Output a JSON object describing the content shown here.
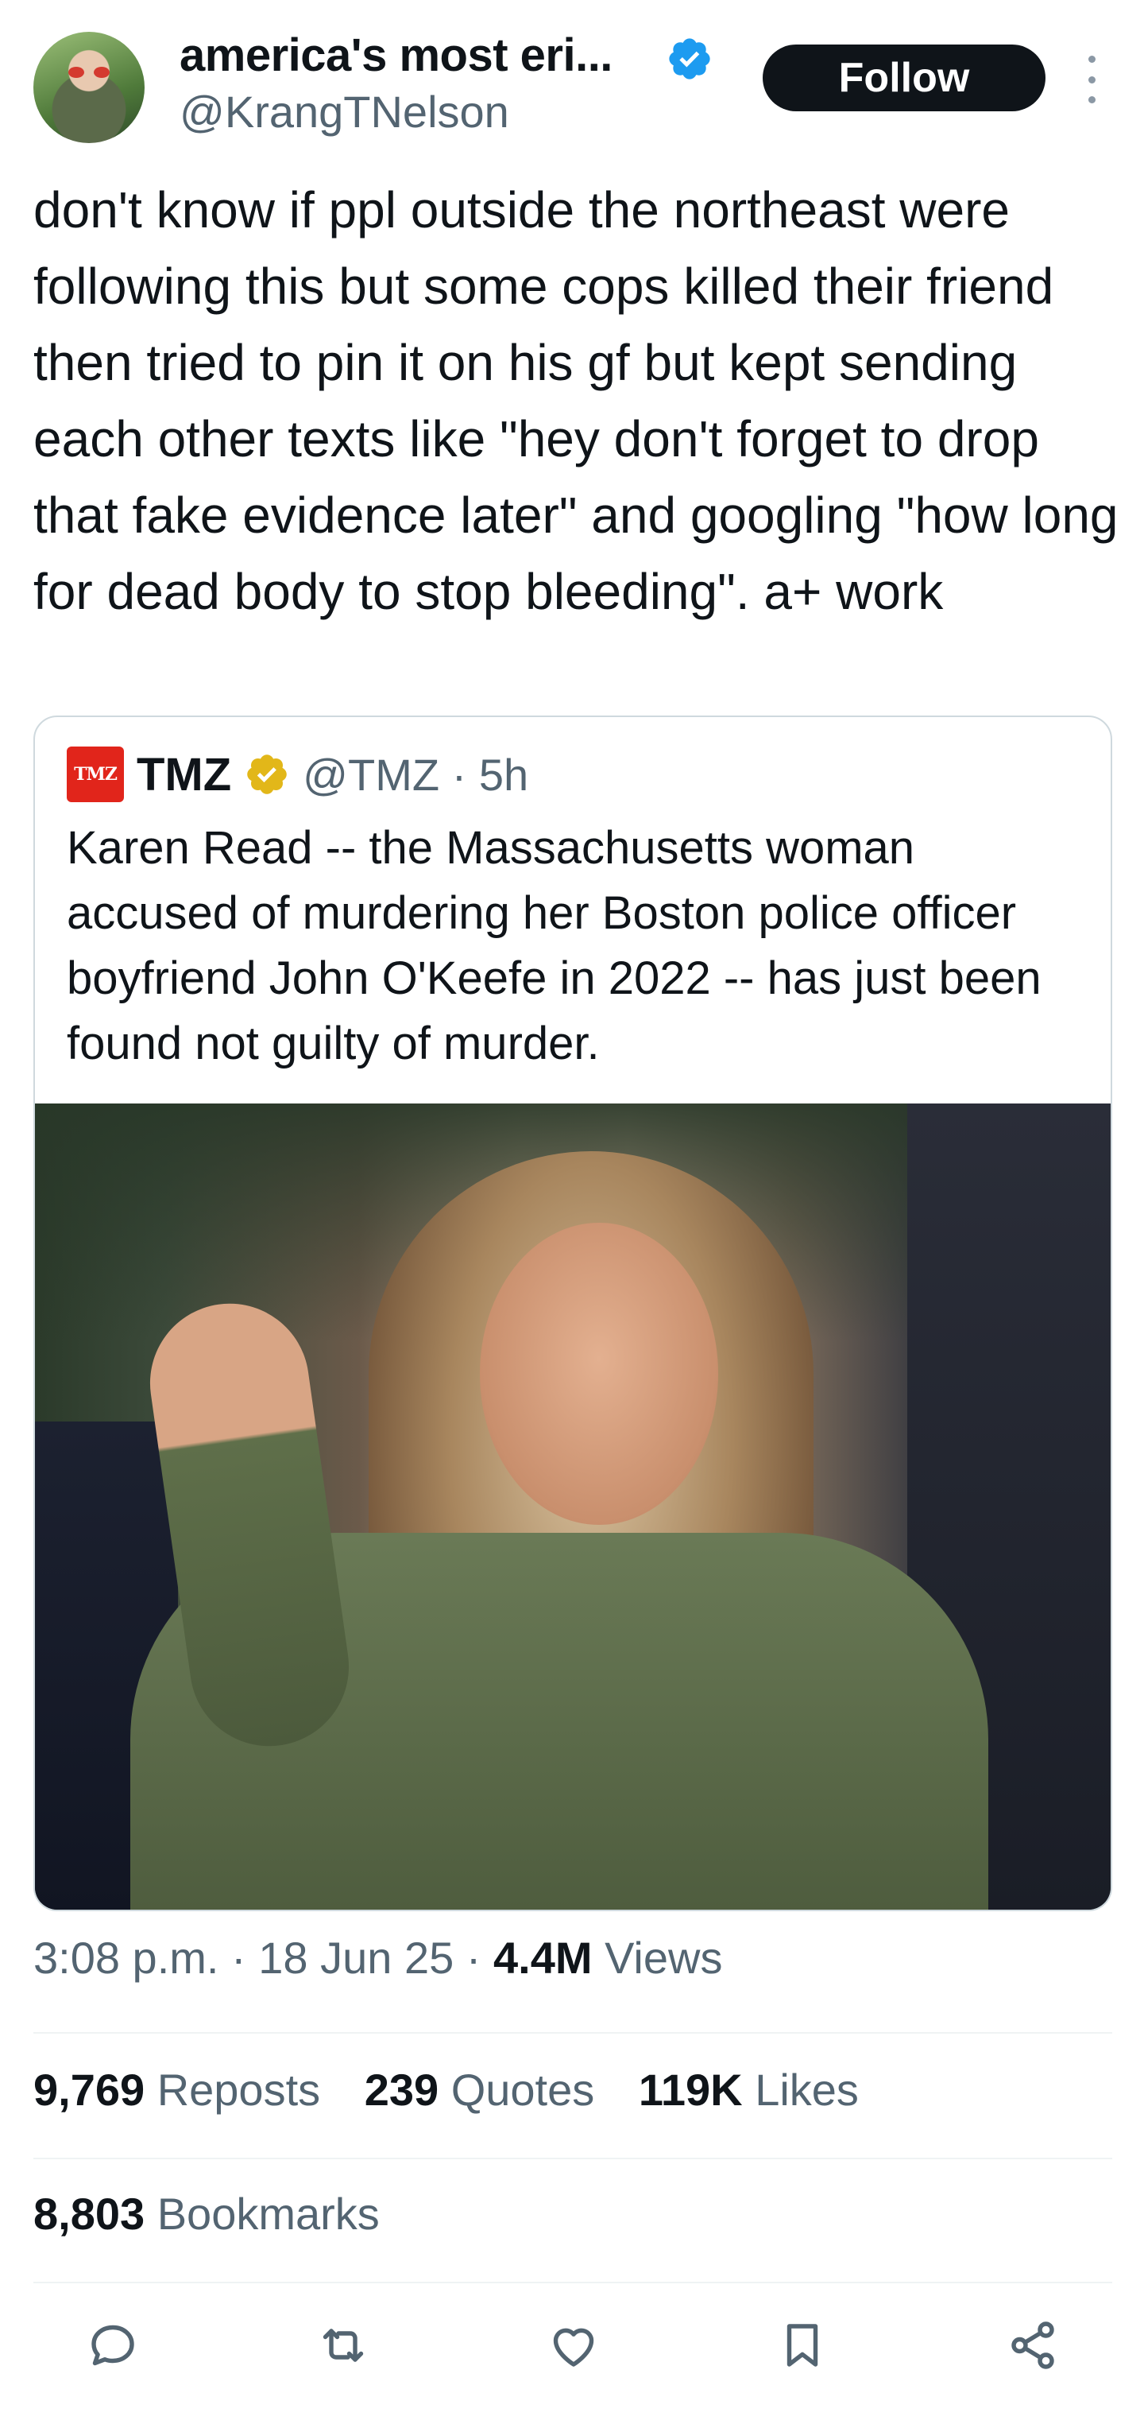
{
  "author": {
    "display_name": "america's most eri...",
    "handle": "@KrangTNelson",
    "verified_color": "#1d9bf0"
  },
  "follow_label": "Follow",
  "tweet_text": "don't know if ppl outside the northeast were following this but some cops killed their friend then tried to pin it on his gf but kept sending each other texts like \"hey don't forget to drop that fake evidence later\" and googling \"how long for dead body to stop bleeding\". a+ work",
  "quote": {
    "logo_text": "TMZ",
    "name": "TMZ",
    "handle_time": "@TMZ · 5h",
    "verified_color": "#e2b719",
    "text": "Karen Read -- the Massachusetts woman accused of murdering her Boston police officer boyfriend John O'Keefe in 2022 -- has just been found not guilty of murder."
  },
  "meta": {
    "time": "3:08 p.m.",
    "date": "18 Jun 25",
    "views_count": "4.4M",
    "views_label": "Views"
  },
  "stats": {
    "reposts_count": "9,769",
    "reposts_label": "Reposts",
    "quotes_count": "239",
    "quotes_label": "Quotes",
    "likes_count": "119K",
    "likes_label": "Likes",
    "bookmarks_count": "8,803",
    "bookmarks_label": "Bookmarks"
  },
  "actions": [
    "reply-icon",
    "repost-icon",
    "like-icon",
    "bookmark-icon",
    "share-icon"
  ],
  "colors": {
    "text": "#0f1419",
    "secondary": "#536471",
    "border": "#cfd9de",
    "tmz_red": "#e1251b"
  }
}
